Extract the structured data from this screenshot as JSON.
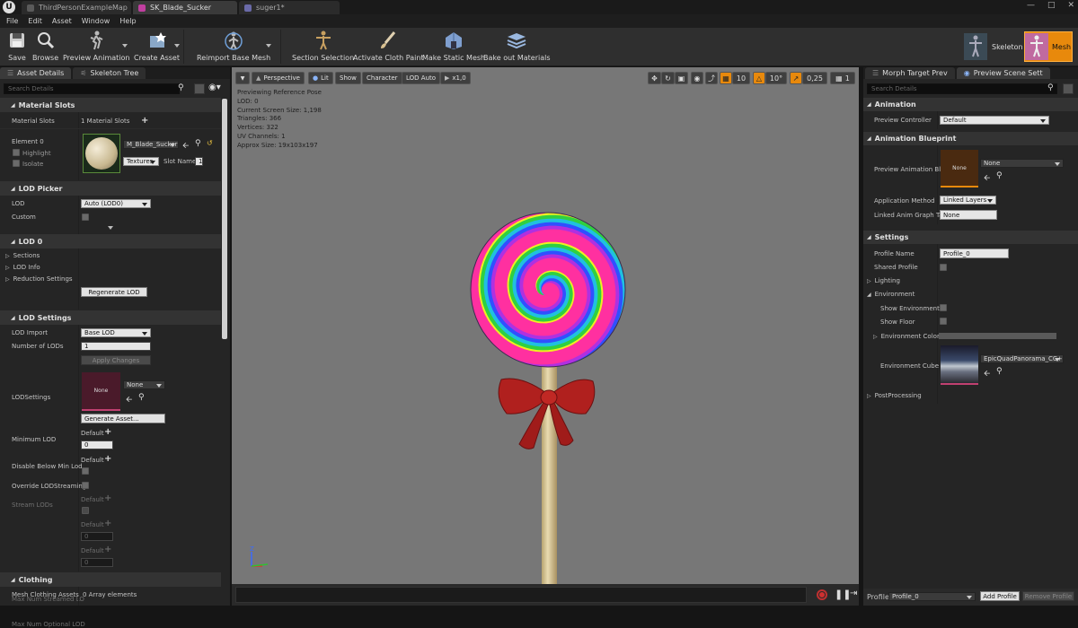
{
  "title_tabs": [
    {
      "label": "ThirdPersonExampleMap",
      "color": "#5a5a5a"
    },
    {
      "label": "SK_Blade_Sucker",
      "color": "#c03fa0"
    },
    {
      "label": "suger1*",
      "color": "#6a6aa8"
    }
  ],
  "menu": [
    "File",
    "Edit",
    "Asset",
    "Window",
    "Help"
  ],
  "toolbar": {
    "save": "Save",
    "browse": "Browse",
    "preview_animation": "Preview Animation",
    "create_asset": "Create Asset",
    "reimport_base_mesh": "Reimport Base Mesh",
    "section_selection": "Section Selection",
    "activate_cloth_paint": "Activate Cloth Paint",
    "make_static_mesh": "Make Static Mesh",
    "bake_out_materials": "Bake out Materials",
    "mode_skeleton": "Skeleton",
    "mode_mesh": "Mesh"
  },
  "left": {
    "tab_details": "Asset Details",
    "tab_skeleton": "Skeleton Tree",
    "search_placeholder": "Search Details",
    "material_slots": {
      "section": "Material Slots",
      "label": "Material Slots",
      "value": "1 Material Slots",
      "element": "Element 0",
      "highlight": "Highlight",
      "isolate": "Isolate",
      "material_name": "M_Blade_Sucker",
      "textures": "Textures",
      "slot_name": "Slot Name",
      "slot_value": "1"
    },
    "lod_picker": {
      "section": "LOD Picker",
      "lod_label": "LOD",
      "lod_value": "Auto (LOD0)",
      "custom_label": "Custom"
    },
    "lod0": {
      "section": "LOD 0",
      "sections": "Sections",
      "lod_info": "LOD Info",
      "reduction": "Reduction Settings",
      "regenerate": "Regenerate LOD"
    },
    "lod_settings": {
      "section": "LOD Settings",
      "lod_import": "LOD Import",
      "lod_import_value": "Base LOD",
      "num_lods": "Number of LODs",
      "num_lods_value": "1",
      "apply_changes": "Apply Changes",
      "lod_settings_label": "LODSettings",
      "lod_settings_asset": "None",
      "lod_settings_combo": "None",
      "generate_asset": "Generate Asset...",
      "min_lod": "Minimum LOD",
      "default": "Default",
      "min_lod_value": "0",
      "disable_below_min": "Disable Below Min Lod",
      "override_streaming": "Override LODStreaming",
      "stream_lods": "Stream LODs",
      "max_num_streamed": "Max Num Streamed LO",
      "max_num_streamed_value": "0",
      "max_num_optional": "Max Num Optional LOD",
      "max_num_optional_value": "0"
    },
    "clothing": {
      "section": "Clothing",
      "assets_label": "Mesh Clothing Assets",
      "assets_value": "0 Array elements"
    }
  },
  "viewport": {
    "perspective": "Perspective",
    "lit": "Lit",
    "show": "Show",
    "character": "Character",
    "lod_auto": "LOD Auto",
    "speed": "x1,0",
    "grid_snap": "10",
    "rot_snap": "10°",
    "scale_snap": "0,25",
    "cam_speed": "1",
    "stats": [
      "Previewing Reference Pose",
      "LOD: 0",
      "Current Screen Size: 1,198",
      "Triangles: 366",
      "Vertices: 322",
      "UV Channels: 1",
      "Approx Size: 19x103x197"
    ],
    "axis_z": "Z"
  },
  "right": {
    "tab_morph": "Morph Target Prev",
    "tab_scene": "Preview Scene Sett",
    "search_placeholder": "Search Details",
    "animation_section": "Animation",
    "preview_controller": "Preview Controller",
    "preview_controller_value": "Default",
    "anim_bp_section": "Animation Blueprint",
    "preview_anim_bp": "Preview Animation Bl",
    "preview_anim_bp_asset": "None",
    "preview_anim_bp_combo": "None",
    "application_method": "Application Method",
    "application_method_value": "Linked Layers",
    "linked_anim_graph": "Linked Anim Graph Ta",
    "linked_anim_graph_value": "None",
    "settings_section": "Settings",
    "profile_name": "Profile Name",
    "profile_name_value": "Profile_0",
    "shared_profile": "Shared Profile",
    "lighting": "Lighting",
    "environment": "Environment",
    "show_environment": "Show Environment",
    "show_floor": "Show Floor",
    "environment_color": "Environment Color",
    "environment_cube": "Environment Cube M",
    "environment_cube_value": "EpicQuadPanorama_CC+EV",
    "post_processing": "PostProcessing",
    "profile_label": "Profile",
    "profile_combo": "Profile_0",
    "add_profile": "Add Profile",
    "remove_profile": "Remove Profile"
  },
  "colors": {
    "accent_orange": "#e8890c",
    "viewport_bg": "#777777",
    "bow_red": "#b0201e",
    "stick": "#d6c48e"
  }
}
